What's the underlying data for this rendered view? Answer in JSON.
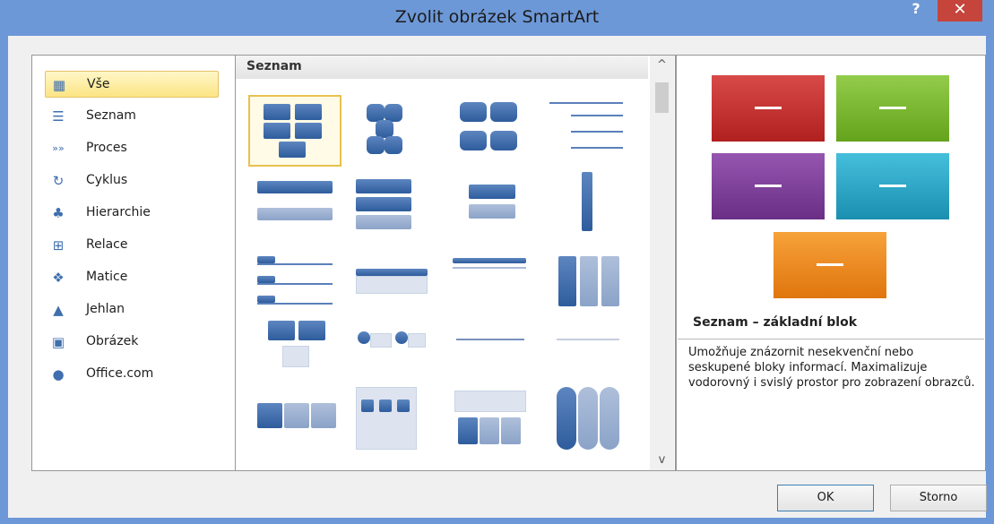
{
  "window": {
    "title": "Zvolit obrázek SmartArt",
    "help_label": "?",
    "close_label": "✕"
  },
  "categories": [
    {
      "label": "Vše",
      "icon": "all-icon"
    },
    {
      "label": "Seznam",
      "icon": "list-icon"
    },
    {
      "label": "Proces",
      "icon": "process-icon"
    },
    {
      "label": "Cyklus",
      "icon": "cycle-icon"
    },
    {
      "label": "Hierarchie",
      "icon": "hierarchy-icon"
    },
    {
      "label": "Relace",
      "icon": "relationship-icon"
    },
    {
      "label": "Matice",
      "icon": "matrix-icon"
    },
    {
      "label": "Jehlan",
      "icon": "pyramid-icon"
    },
    {
      "label": "Obrázek",
      "icon": "picture-icon"
    },
    {
      "label": "Office.com",
      "icon": "office-com-icon"
    }
  ],
  "gallery": {
    "section_title": "Seznam",
    "scroll_up": "^",
    "scroll_down": "v"
  },
  "preview": {
    "title": "Seznam – základní blok",
    "description": "Umožňuje znázornit nesekvenční nebo seskupené bloky informací. Maximalizuje vodorovný i svislý prostor pro zobrazení obrazců.",
    "colors": [
      "#c8302e",
      "#7bb82e",
      "#7f3f9a",
      "#2aa8c7",
      "#f08a1c"
    ]
  },
  "buttons": {
    "ok": "OK",
    "cancel": "Storno"
  }
}
